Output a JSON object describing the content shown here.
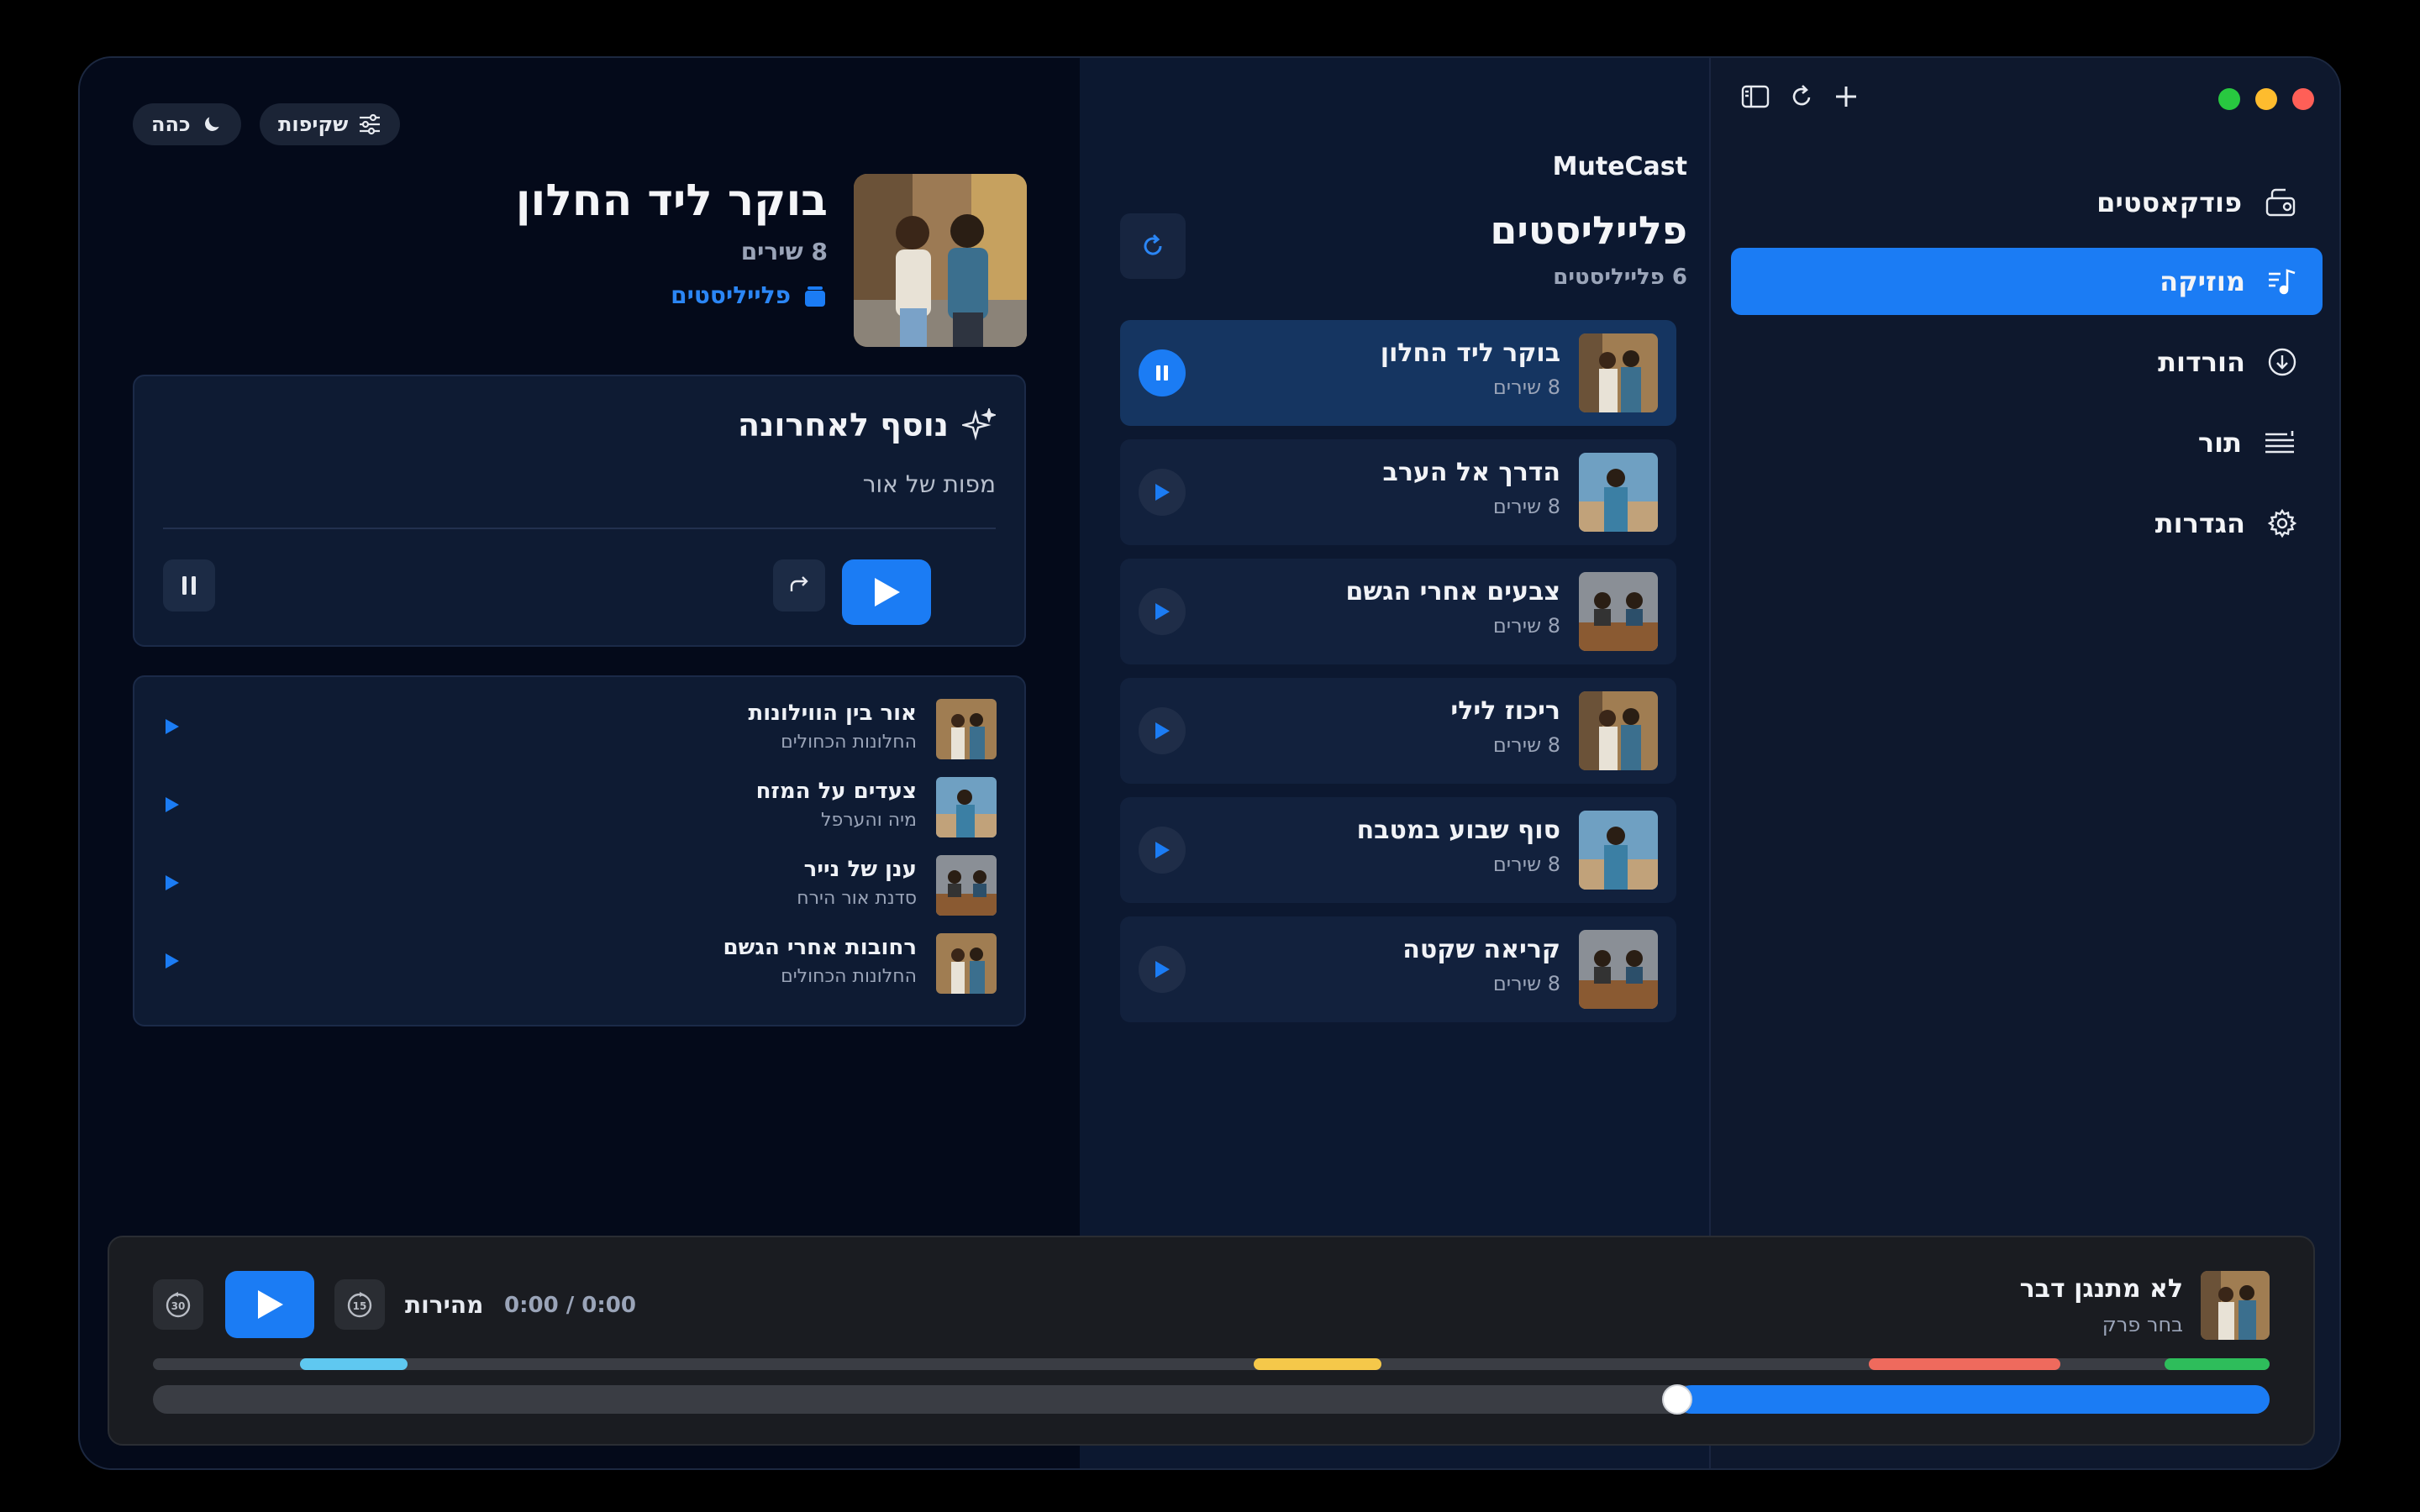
{
  "app": {
    "name": "MuteCast"
  },
  "colors": {
    "accent": "#1b7cf4",
    "close": "#ff5f57",
    "minimize": "#febc2e",
    "maximize": "#28c840"
  },
  "toolbar": {
    "icons": [
      "sidebar-icon",
      "refresh-icon",
      "plus-icon"
    ]
  },
  "sidebar": {
    "items": [
      {
        "label": "פודקאסטים",
        "icon": "podcast-icon",
        "active": false
      },
      {
        "label": "מוזיקה",
        "icon": "music-note-icon",
        "active": true
      },
      {
        "label": "הורדות",
        "icon": "download-icon",
        "active": false
      },
      {
        "label": "תור",
        "icon": "queue-icon",
        "active": false
      },
      {
        "label": "הגדרות",
        "icon": "gear-icon",
        "active": false
      }
    ]
  },
  "playlists": {
    "title": "פלייליסטים",
    "count": "6 פלייליסטים",
    "items": [
      {
        "title": "בוקר ליד החלון",
        "sub": "8 שירים",
        "active": true
      },
      {
        "title": "הדרך אל הערב",
        "sub": "8 שירים",
        "active": false
      },
      {
        "title": "צבעים אחרי הגשם",
        "sub": "8 שירים",
        "active": false
      },
      {
        "title": "ריכוז לילי",
        "sub": "8 שירים",
        "active": false
      },
      {
        "title": "סוף שבוע במטבח",
        "sub": "8 שירים",
        "active": false
      },
      {
        "title": "קריאה שקטה",
        "sub": "8 שירים",
        "active": false
      }
    ]
  },
  "header_pills": {
    "theme_label": "כהה",
    "transparency_label": "שקיפות"
  },
  "detail": {
    "title": "בוקר ליד החלון",
    "count": "8 שירים",
    "link": "פלייליסטים",
    "recent": {
      "heading": "נוסף לאחרונה",
      "subtitle": "מפות של אור"
    },
    "tracks": [
      {
        "title": "אור בין הווילונות",
        "artist": "החלונות הכחולים"
      },
      {
        "title": "צעדים על המזח",
        "artist": "מיה והערפל"
      },
      {
        "title": "ענן של נייר",
        "artist": "סדנת אור הירח"
      },
      {
        "title": "רחובות אחרי הגשם",
        "artist": "החלונות הכחולים"
      }
    ]
  },
  "player": {
    "title": "לא מתנגן דבר",
    "subtitle": "בחר פרק",
    "time": "0:00 / 0:00",
    "speed_label": "מהירות",
    "skip_back": "15",
    "skip_forward": "30",
    "progress_fraction": 0.28,
    "chapter_colors": [
      "#5fc8f0",
      "#f5c84a",
      "#ef6a5d",
      "#2ebd5b"
    ]
  }
}
